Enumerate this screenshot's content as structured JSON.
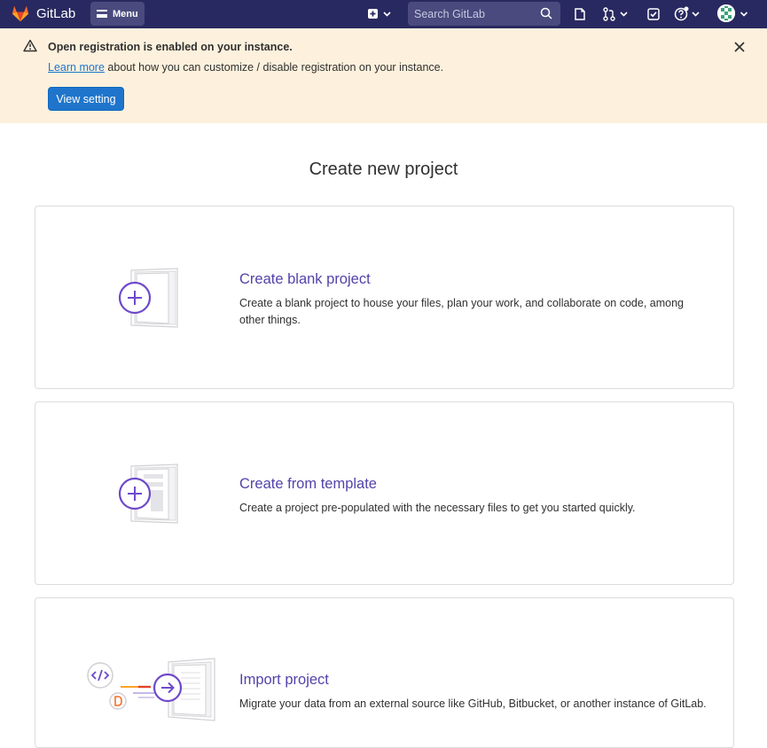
{
  "topbar": {
    "brand": "GitLab",
    "menu_label": "Menu",
    "search_placeholder": "Search GitLab"
  },
  "banner": {
    "title": "Open registration is enabled on your instance.",
    "learn_more": "Learn more",
    "text_rest": " about how you can customize / disable registration on your instance.",
    "button_label": "View setting"
  },
  "page": {
    "title": "Create new project"
  },
  "cards": [
    {
      "title": "Create blank project",
      "description": "Create a blank project to house your files, plan your work, and collaborate on code, among other things."
    },
    {
      "title": "Create from template",
      "description": "Create a project pre-populated with the necessary files to get you started quickly."
    },
    {
      "title": "Import project",
      "description": "Migrate your data from an external source like GitHub, Bitbucket, or another instance of GitLab."
    }
  ],
  "colors": {
    "topbar": "#292961",
    "banner_bg": "#fdf1dd",
    "primary_button": "#1f75cb",
    "card_title": "#5243aa"
  }
}
